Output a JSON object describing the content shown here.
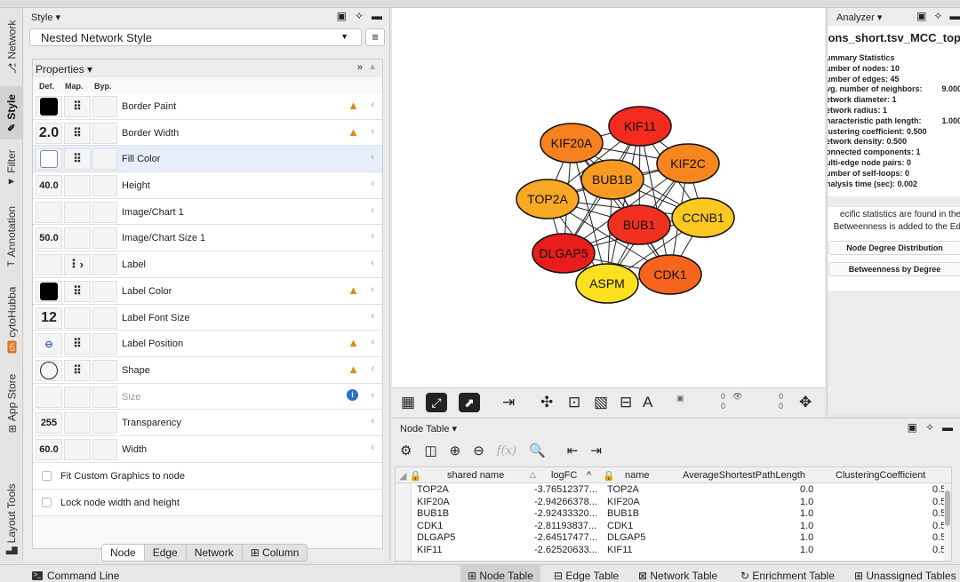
{
  "left_tabs": [
    {
      "label": "Network",
      "icon": "network-icon",
      "glyph": "⎇"
    },
    {
      "label": "Style",
      "icon": "brush-icon",
      "glyph": "✎"
    },
    {
      "label": "Filter",
      "icon": "filter-icon",
      "glyph": "▼"
    },
    {
      "label": "Annotation",
      "icon": "annotation-icon",
      "glyph": "T"
    },
    {
      "label": "cytoHubba",
      "icon": "cytohubba-icon",
      "glyph": "ch"
    },
    {
      "label": "App Store",
      "icon": "appstore-icon",
      "glyph": "⊞"
    },
    {
      "label": "Layout Tools",
      "icon": "layout-tools-icon",
      "glyph": "▙"
    }
  ],
  "style_panel": {
    "header": "Style ▾",
    "style_name": "Nested Network Style",
    "properties_label": "Properties ▾",
    "columns": {
      "def": "Def.",
      "map": "Map.",
      "byp": "Byp."
    },
    "rows": [
      {
        "label": "Border Paint",
        "def_text": "",
        "def_type": "black",
        "map": "⠿",
        "warn": true,
        "info": false,
        "selected": false,
        "disabled": false
      },
      {
        "label": "Border Width",
        "def_text": "2.0",
        "def_type": "text-big",
        "map": "⠿",
        "warn": true,
        "info": false,
        "selected": false,
        "disabled": false
      },
      {
        "label": "Fill Color",
        "def_text": "",
        "def_type": "white",
        "map": "⠿",
        "warn": false,
        "info": false,
        "selected": true,
        "disabled": false
      },
      {
        "label": "Height",
        "def_text": "40.0",
        "def_type": "text",
        "map": "",
        "warn": false,
        "info": false,
        "selected": false,
        "disabled": false
      },
      {
        "label": "Image/Chart 1",
        "def_text": "",
        "def_type": "empty",
        "map": "",
        "warn": false,
        "info": false,
        "selected": false,
        "disabled": false
      },
      {
        "label": "Image/Chart Size 1",
        "def_text": "50.0",
        "def_type": "text",
        "map": "",
        "warn": false,
        "info": false,
        "selected": false,
        "disabled": false
      },
      {
        "label": "Label",
        "def_text": "",
        "def_type": "empty",
        "map": "⠇›",
        "warn": false,
        "info": false,
        "selected": false,
        "disabled": false
      },
      {
        "label": "Label Color",
        "def_text": "",
        "def_type": "black",
        "map": "⠿",
        "warn": true,
        "info": false,
        "selected": false,
        "disabled": false
      },
      {
        "label": "Label Font Size",
        "def_text": "12",
        "def_type": "text-big",
        "map": "",
        "warn": false,
        "info": false,
        "selected": false,
        "disabled": false
      },
      {
        "label": "Label Position",
        "def_text": "⊖",
        "def_type": "glyph",
        "map": "⠿",
        "warn": true,
        "info": false,
        "selected": false,
        "disabled": false
      },
      {
        "label": "Shape",
        "def_text": "",
        "def_type": "circle",
        "map": "⠿",
        "warn": true,
        "info": false,
        "selected": false,
        "disabled": false
      },
      {
        "label": "Size",
        "def_text": "",
        "def_type": "empty",
        "map": "",
        "warn": false,
        "info": true,
        "selected": false,
        "disabled": true
      },
      {
        "label": "Transparency",
        "def_text": "255",
        "def_type": "text",
        "map": "",
        "warn": false,
        "info": false,
        "selected": false,
        "disabled": false
      },
      {
        "label": "Width",
        "def_text": "60.0",
        "def_type": "text",
        "map": "",
        "warn": false,
        "info": false,
        "selected": false,
        "disabled": false
      }
    ],
    "checkboxes": [
      {
        "label": "Fit Custom Graphics to node"
      },
      {
        "label": "Lock node width and height"
      }
    ],
    "bottom_tabs": [
      "Node",
      "Edge",
      "Network",
      "⊞ Column"
    ],
    "active_bottom_tab": 0
  },
  "network": {
    "nodes": [
      {
        "id": "KIF11",
        "color": "#f22b1e"
      },
      {
        "id": "KIF20A",
        "color": "#f7811e"
      },
      {
        "id": "KIF2C",
        "color": "#f8861e"
      },
      {
        "id": "BUB1B",
        "color": "#f89a22"
      },
      {
        "id": "TOP2A",
        "color": "#f9a824"
      },
      {
        "id": "CCNB1",
        "color": "#fdc81f"
      },
      {
        "id": "BUB1",
        "color": "#f2301f"
      },
      {
        "id": "DLGAP5",
        "color": "#ea1d1d"
      },
      {
        "id": "CDK1",
        "color": "#f6641d"
      },
      {
        "id": "ASPM",
        "color": "#fde020"
      }
    ],
    "toolbar_counts": {
      "a": "0",
      "b": "0",
      "c": "0",
      "d": "0"
    }
  },
  "analyzer": {
    "header": "Analyzer ▾",
    "title": "ractions_short.tsv_MCC_top",
    "stats": [
      {
        "k": "ummary Statistics",
        "v": ""
      },
      {
        "k": "umber of nodes:  10",
        "v": ""
      },
      {
        "k": "umber of edges:  45",
        "v": ""
      },
      {
        "k": "vg. number of neighbors:",
        "v": "9.000"
      },
      {
        "k": "etwork diameter:  1",
        "v": ""
      },
      {
        "k": "etwork radius:  1",
        "v": ""
      },
      {
        "k": "haracteristic path length:",
        "v": "1.000"
      },
      {
        "k": "lustering coefficient:  0.500",
        "v": ""
      },
      {
        "k": "etwork density:  0.500",
        "v": ""
      },
      {
        "k": "onnected components:  1",
        "v": ""
      },
      {
        "k": "ulti-edge node pairs:  0",
        "v": ""
      },
      {
        "k": "umber of self-loops:  0",
        "v": ""
      },
      {
        "k": "nalysis time (sec):  0.002",
        "v": ""
      }
    ],
    "note1": "ecific statistics are found in the",
    "note2": "Betweenness is added to the Ed",
    "btn1": "Node Degree Distribution",
    "btn2": "Betweenness by Degree"
  },
  "node_table": {
    "header": "Node Table ▾",
    "columns": [
      "shared name",
      "logFC",
      "name",
      "AverageShortestPathLength",
      "ClusteringCoefficient"
    ],
    "rows": [
      [
        "TOP2A",
        "-3.76512377...",
        "TOP2A",
        "0.0",
        "0.5"
      ],
      [
        "KIF20A",
        "-2.94266378...",
        "KIF20A",
        "1.0",
        "0.5"
      ],
      [
        "BUB1B",
        "-2.92433320...",
        "BUB1B",
        "1.0",
        "0.5"
      ],
      [
        "CDK1",
        "-2.81193837...",
        "CDK1",
        "1.0",
        "0.5"
      ],
      [
        "DLGAP5",
        "-2.64517477...",
        "DLGAP5",
        "1.0",
        "0.5"
      ],
      [
        "KIF11",
        "-2.62520633...",
        "KIF11",
        "1.0",
        "0.5"
      ]
    ]
  },
  "statusbar": {
    "command_line": "Command Line",
    "tabs": [
      "Node Table",
      "Edge Table",
      "Network Table",
      "Enrichment Table",
      "Unassigned Tables"
    ],
    "tab_icons": [
      "⊞",
      "⊟",
      "⊠",
      "↻",
      "⊞"
    ],
    "active_tab": 0
  }
}
